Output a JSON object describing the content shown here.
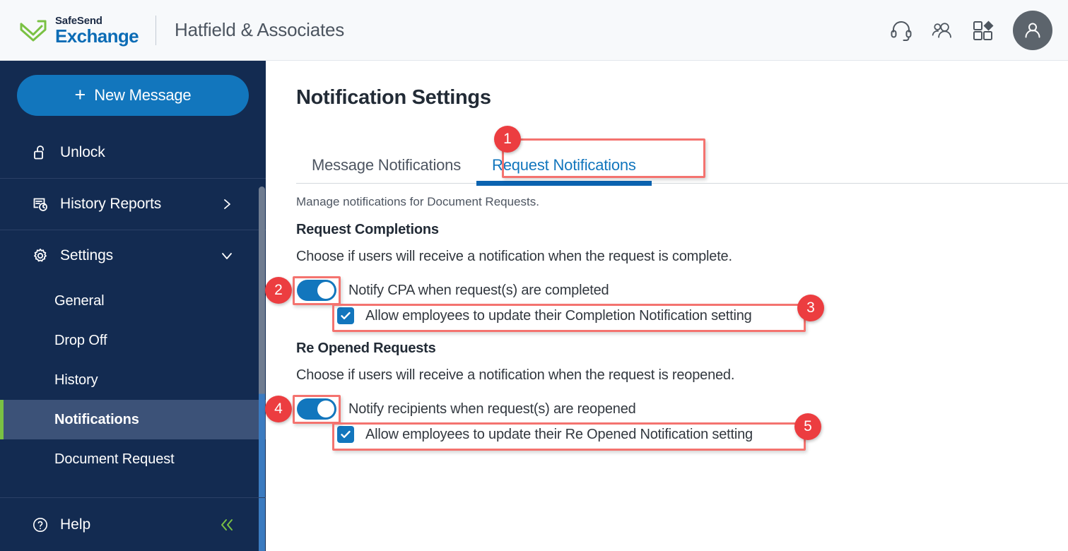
{
  "header": {
    "logo": {
      "mark_icon": "safesend-envelope-icon",
      "line1": "SafeSend",
      "line2": "Exchange"
    },
    "org_name": "Hatfield & Associates",
    "actions": [
      {
        "icon": "headset-support-icon",
        "name": "support-icon"
      },
      {
        "icon": "people-users-icon",
        "name": "contacts-icon"
      },
      {
        "icon": "apps-grid-icon",
        "name": "apps-icon"
      }
    ],
    "avatar_icon": "user-avatar-icon"
  },
  "sidebar": {
    "new_message": {
      "label": "New Message",
      "icon": "plus-icon"
    },
    "items": [
      {
        "label": "Unlock",
        "icon": "unlock-padlock-icon",
        "chevron": null
      },
      {
        "label": "History Reports",
        "icon": "history-report-icon",
        "chevron": "chevron-right-icon"
      },
      {
        "label": "Settings",
        "icon": "gear-icon",
        "chevron": "chevron-down-icon"
      }
    ],
    "sub_items": [
      {
        "label": "General",
        "active": false
      },
      {
        "label": "Drop Off",
        "active": false
      },
      {
        "label": "History",
        "active": false
      },
      {
        "label": "Notifications",
        "active": true
      },
      {
        "label": "Document Request",
        "active": false
      }
    ],
    "footer": {
      "help_label": "Help",
      "help_icon": "question-circle-icon",
      "collapse_icon": "double-chevron-left-icon"
    },
    "accent_color": "#7ac143",
    "background_color": "#132b51",
    "active_item_color": "#3c5278"
  },
  "main": {
    "page_title": "Notification Settings",
    "tabs": [
      {
        "label": "Message Notifications",
        "active": false
      },
      {
        "label": "Request Notifications",
        "active": true
      }
    ],
    "subtitle": "Manage notifications for Document Requests.",
    "sections": [
      {
        "heading": "Request Completions",
        "description": "Choose if users will receive a notification when the request is complete.",
        "toggle": {
          "label": "Notify CPA when request(s) are completed",
          "on": true
        },
        "checkbox": {
          "label": "Allow employees to update their Completion Notification setting",
          "checked": true
        }
      },
      {
        "heading": "Re Opened Requests",
        "description": "Choose if users will receive a notification when the request is reopened.",
        "toggle": {
          "label": "Notify recipients when request(s) are reopened",
          "on": true
        },
        "checkbox": {
          "label": "Allow employees to update their Re Opened Notification setting",
          "checked": true
        }
      }
    ],
    "accent_color": "#1276bd"
  },
  "annotations": {
    "badge_color": "#ec3d40",
    "box_color": "#f4736f",
    "badges": [
      {
        "number": "1",
        "target": "request-notifications-tab"
      },
      {
        "number": "2",
        "target": "completion-toggle"
      },
      {
        "number": "3",
        "target": "completion-checkbox"
      },
      {
        "number": "4",
        "target": "reopened-toggle"
      },
      {
        "number": "5",
        "target": "reopened-checkbox"
      }
    ]
  }
}
